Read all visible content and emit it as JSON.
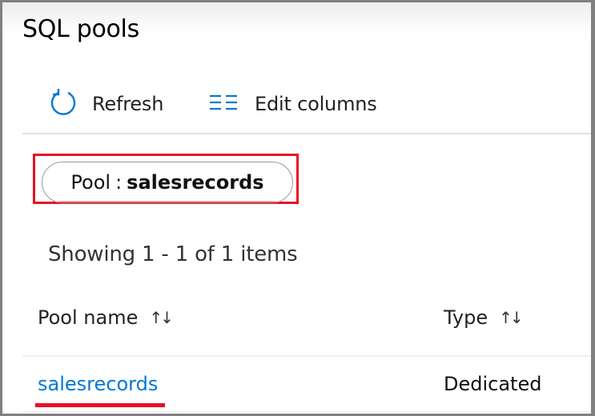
{
  "page": {
    "title": "SQL pools"
  },
  "toolbar": {
    "refresh_label": "Refresh",
    "edit_columns_label": "Edit columns"
  },
  "filter": {
    "key": "Pool",
    "separator": ":",
    "value": "salesrecords"
  },
  "list": {
    "status": "Showing 1 - 1 of 1 items",
    "columns": [
      {
        "label": "Pool name",
        "sort_icon": "↑↓"
      },
      {
        "label": "Type",
        "sort_icon": "↑↓"
      }
    ],
    "rows": [
      {
        "pool_name": "salesrecords",
        "type": "Dedicated"
      }
    ]
  },
  "colors": {
    "accent": "#0078d4",
    "highlight": "#e81123",
    "frame": "#808080"
  }
}
